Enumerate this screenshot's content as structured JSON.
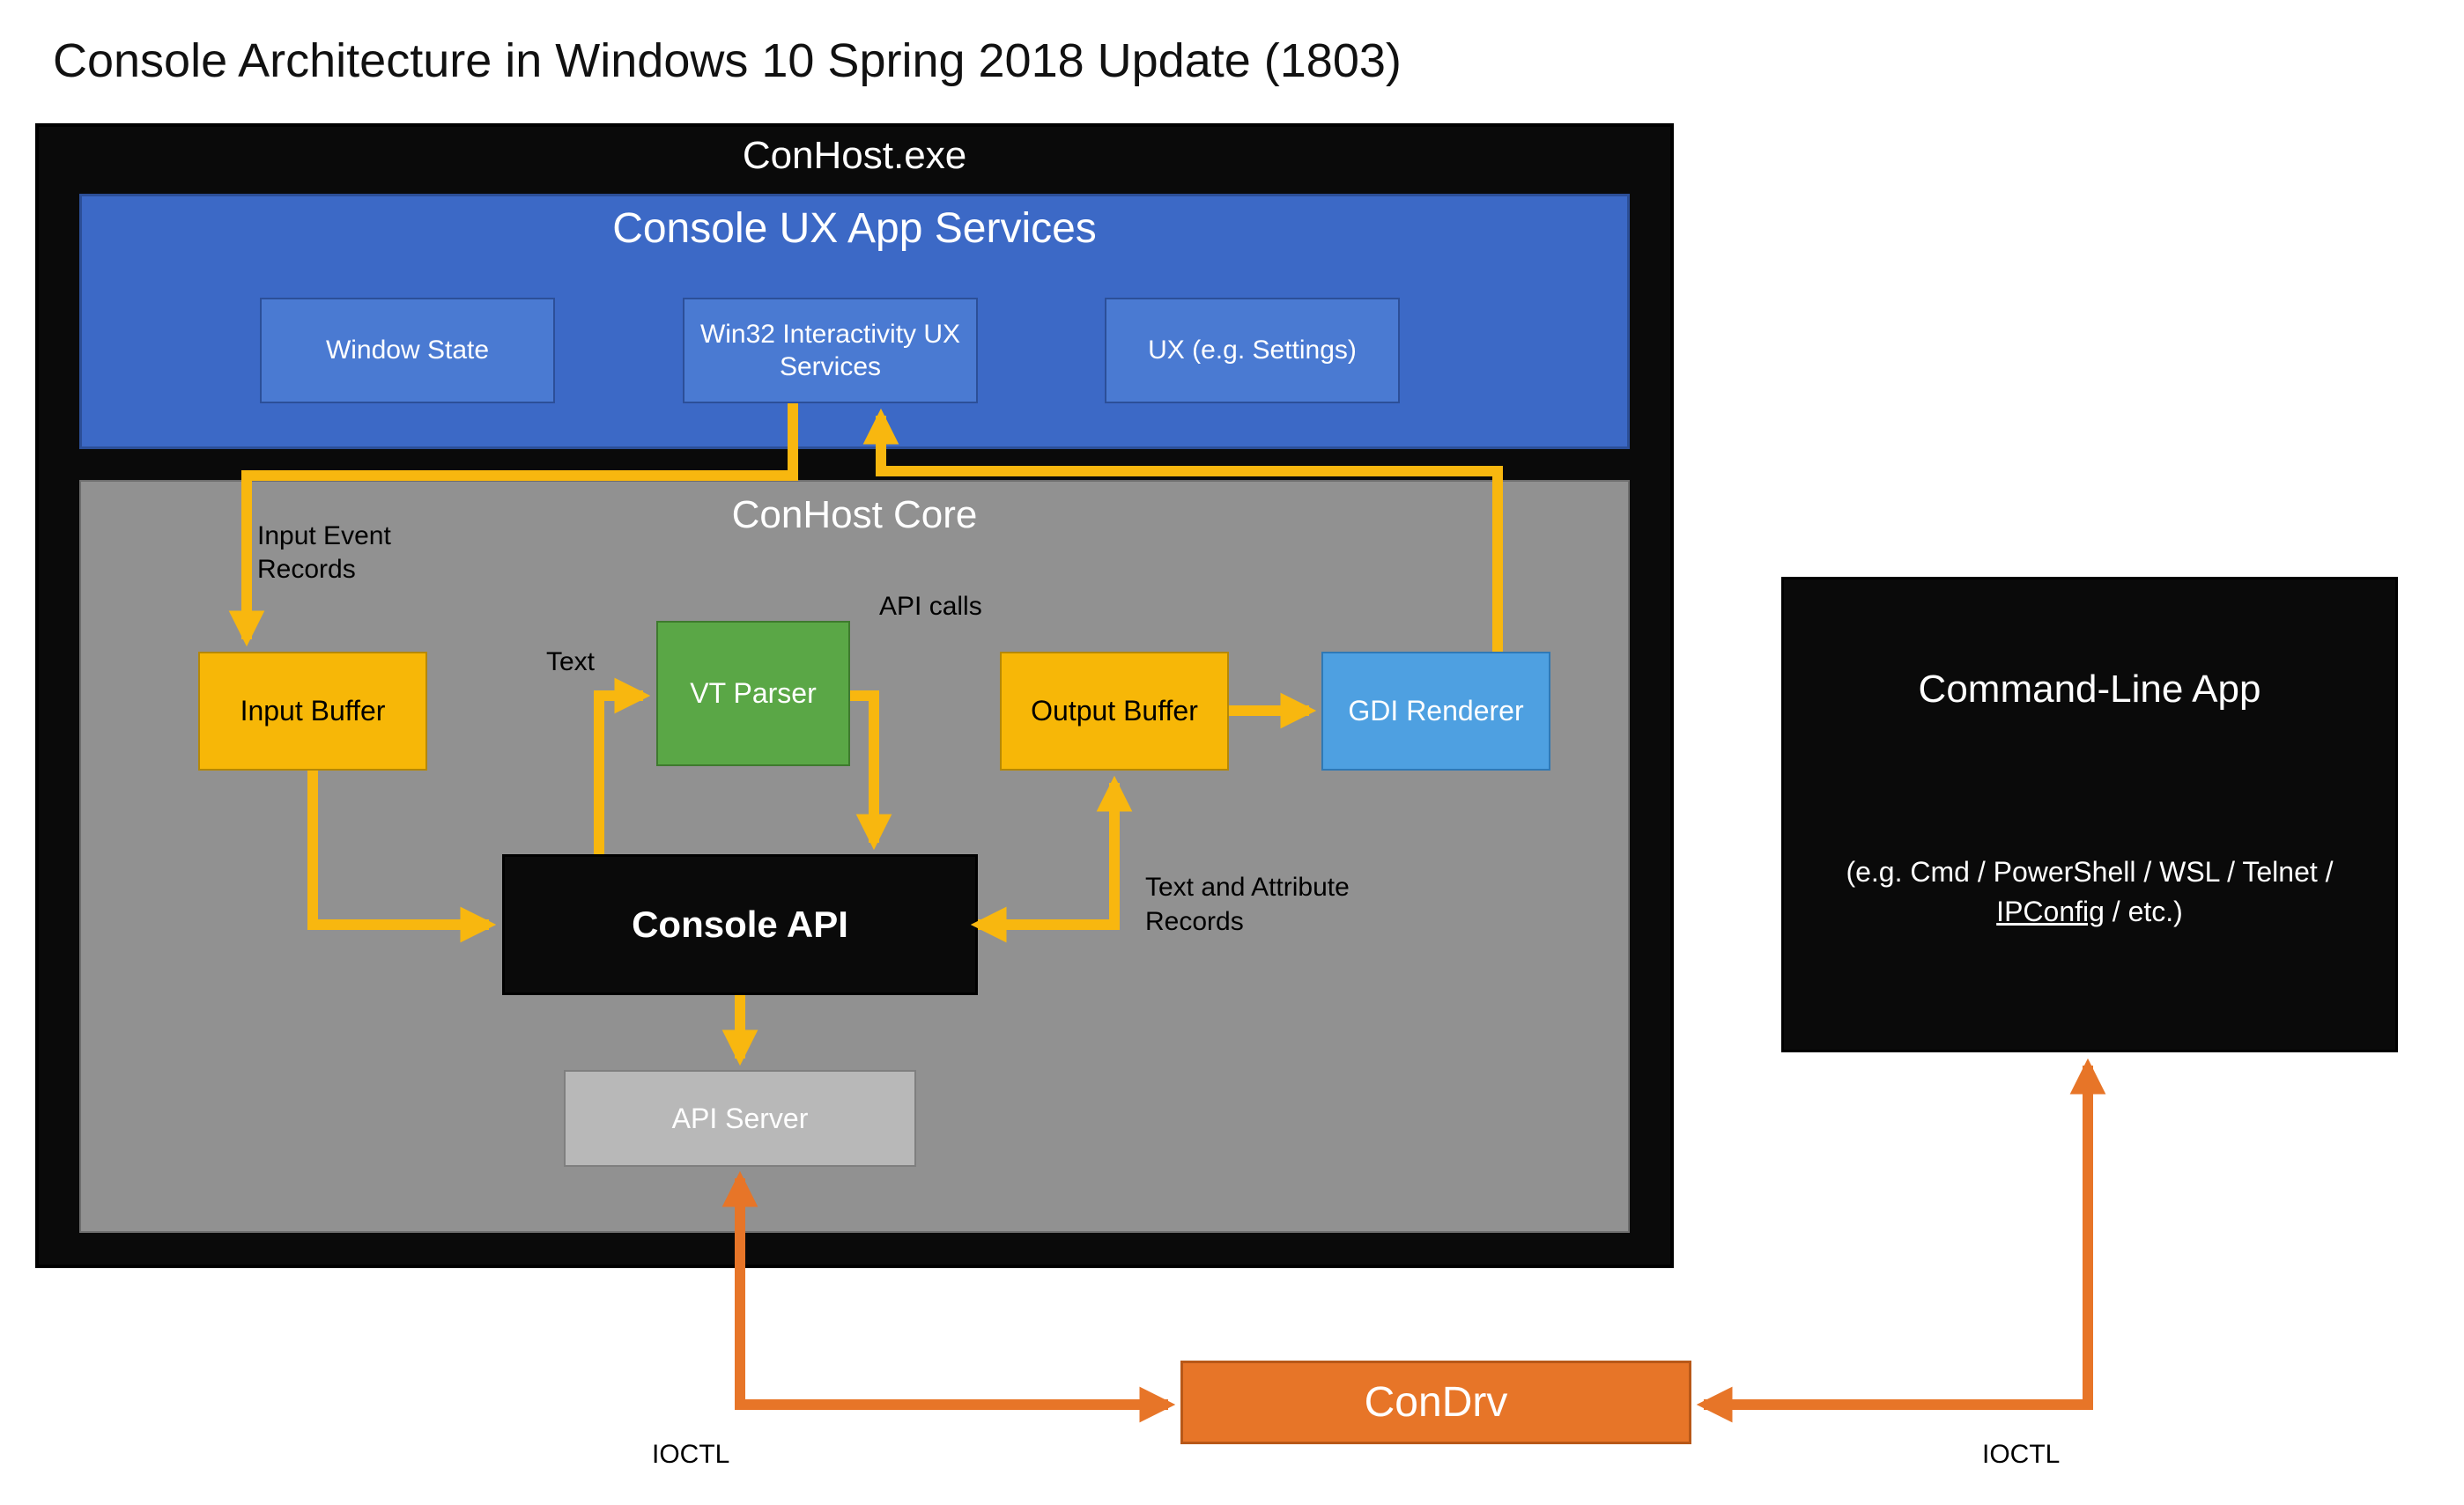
{
  "title": "Console Architecture in Windows 10 Spring 2018 Update (1803)",
  "conhost_exe": {
    "title": "ConHost.exe"
  },
  "ux_services": {
    "title": "Console UX App Services",
    "window_state": "Window State",
    "win32_interact": "Win32 Interactivity UX Services",
    "ux_settings": "UX (e.g. Settings)"
  },
  "conhost_core": {
    "title": "ConHost Core",
    "input_buffer": "Input Buffer",
    "vt_parser": "VT Parser",
    "output_buffer": "Output Buffer",
    "gdi_renderer": "GDI Renderer",
    "console_api": "Console API",
    "api_server": "API Server"
  },
  "cmd_app": {
    "title": "Command-Line App",
    "sub_prefix": "(e.g. Cmd / PowerShell / WSL / Telnet / ",
    "sub_ul": "IPConfig",
    "sub_suffix": " / etc.)"
  },
  "condrv": "ConDrv",
  "labels": {
    "input_records": "Input Event Records",
    "text": "Text",
    "api_calls": "API calls",
    "text_attr": "Text and Attribute Records",
    "ioctl": "IOCTL"
  },
  "arrows": {
    "color": "#f8b70f",
    "orange": "#e77528",
    "stroke": 12,
    "strokeThin": 10
  }
}
